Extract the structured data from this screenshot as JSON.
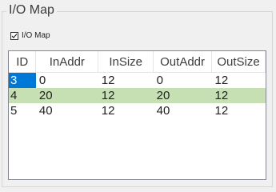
{
  "group": {
    "title": "I/O Map"
  },
  "checkbox": {
    "label": "I/O Map",
    "checked": true
  },
  "table": {
    "headers": [
      "ID",
      "InAddr",
      "InSize",
      "OutAddr",
      "OutSize"
    ],
    "rows": [
      [
        "3",
        "0",
        "12",
        "0",
        "12"
      ],
      [
        "4",
        "20",
        "12",
        "20",
        "12"
      ],
      [
        "5",
        "40",
        "12",
        "40",
        "12"
      ]
    ]
  },
  "colors": {
    "selection_blue": "#0078d7",
    "highlight_green": "#c6e0b4"
  }
}
